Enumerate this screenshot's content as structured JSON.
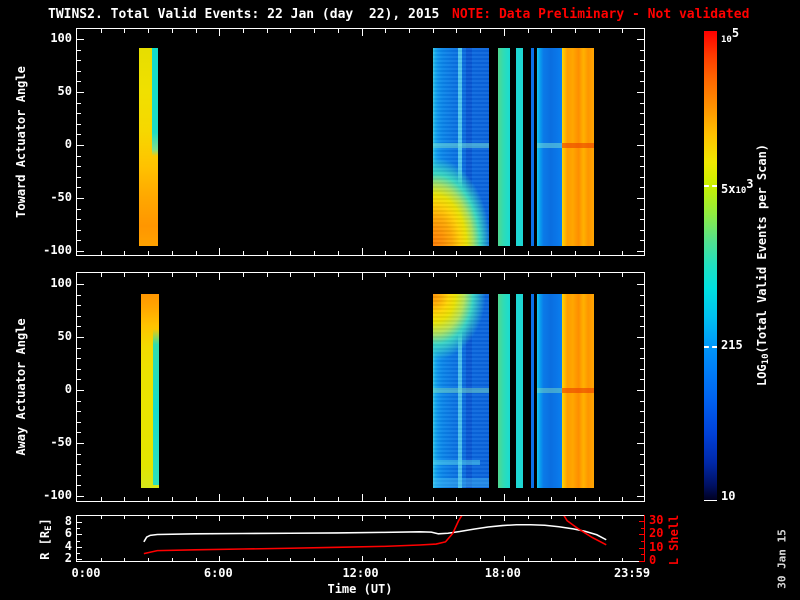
{
  "header": {
    "title": "TWINS2. Total Valid Events: 22 Jan (day  22), 2015",
    "title_color": "#ffffff",
    "note": "NOTE: Data Preliminary - Not validated",
    "note_color": "#ff0000"
  },
  "footer": {
    "date_stamp": "30 Jan 15"
  },
  "time_axis": {
    "label": "Time (UT)",
    "range_hours": [
      0,
      24
    ],
    "ticks": [
      {
        "hour": 0,
        "label": "0:00"
      },
      {
        "hour": 6,
        "label": "6:00"
      },
      {
        "hour": 12,
        "label": "12:00"
      },
      {
        "hour": 18,
        "label": "18:00"
      },
      {
        "hour": 23.983,
        "label": "23:59"
      }
    ]
  },
  "colorbar": {
    "label_pre": "LOG",
    "label_sub": "10",
    "label_suf": "(Total Valid Events per Scan)",
    "gradient": "linear-gradient(180deg,#ff0000 0%,#ff3800 5%,#ff6400 10%,#ff9000 16%,#ffc000 22%,#f0e800 28%,#c8f000 33%,#90ec40 39%,#50e090 45%,#20e0c0 50%,#00e0e0 55%,#00c0f0 61%,#0098f8 67%,#0080f8 72%,#0060f0 79%,#0040d8 86%,#0028a8 92%,#001060 97%,#000020 100%)",
    "scale": "log",
    "range": [
      10,
      100000
    ],
    "ticks": [
      {
        "pre": "",
        "small": "10",
        "sup": "5",
        "value": 100000,
        "frac": 0.0,
        "dashed": false
      },
      {
        "pre": "5x",
        "small": "10",
        "sup": "3",
        "value": 5000,
        "frac": 0.328,
        "dashed": true
      },
      {
        "pre": "215",
        "small": "",
        "sup": "",
        "value": 215,
        "frac": 0.672,
        "dashed": true
      },
      {
        "pre": "10",
        "small": "",
        "sup": "",
        "value": 10,
        "frac": 1.0,
        "dashed": false
      }
    ]
  },
  "chart_data": [
    {
      "id": "toward",
      "type": "heatmap",
      "ylabel": "Toward Actuator Angle",
      "ylim": [
        -100,
        100
      ],
      "yticks": [
        100,
        50,
        0,
        -50,
        -100
      ],
      "bands": [
        {
          "t0": 2.62,
          "t1": 3.43,
          "a0": 92,
          "a1": -95,
          "bg": "linear-gradient(180deg,#e6de00 0%,#f0e000 22%,#f6d800 42%,#ffc200 60%,#ffa800 75%,#ff9600 90%,#ffa200 100%)"
        },
        {
          "t0": 3.16,
          "t1": 3.43,
          "a0": 92,
          "a1": -10,
          "bg": "linear-gradient(180deg,#12dcc8 0%,#1edcc4 78%,#7ee08c 94%,rgba(126,224,140,0) 100%)"
        },
        {
          "t0": 15.02,
          "t1": 17.38,
          "a0": 92,
          "a1": -95,
          "bg": "linear-gradient(90deg,#36c8e2 0%,#14aaee 4%,#0e96ee 9%,#0a88ea 16%,#0a80e8 24%,#0a76e4 36%,#0a6ee0 52%,#0a68de 72%,#0a64dc 100%)"
        },
        {
          "t0": 16.07,
          "t1": 16.24,
          "a0": 92,
          "a1": -95,
          "bg": "rgba(100,226,242,0.75)"
        },
        {
          "t0": 16.41,
          "t1": 16.66,
          "a0": 92,
          "a1": -95,
          "bg": "rgba(6,70,200,0.5)"
        },
        {
          "t0": 15.02,
          "t1": 17.38,
          "a0": 0,
          "a1": -95,
          "bg": "radial-gradient(ellipse 120% 102% at 0% 100%,#ff7c00 0%,#ff8e00 15%,#ffaa00 29%,#ffd200 41%,#eae400 50%,#a6e060 60%,#38d8c0 70%,rgba(10,104,224,0) 86%)"
        },
        {
          "t0": 15.02,
          "t1": 17.38,
          "a0": 92,
          "a1": -95,
          "bg": "repeating-linear-gradient(180deg,rgba(255,255,255,0.05) 0px,rgba(255,255,255,0.05) 2px,rgba(0,0,90,0.06) 2px,rgba(0,0,90,0.06) 4px)"
        },
        {
          "t0": 17.76,
          "t1": 18.26,
          "a0": 92,
          "a1": -95,
          "bg": "linear-gradient(90deg,#52d88e 0%,#2edcb6 48%,#1adcd2 100%)"
        },
        {
          "t0": 18.52,
          "t1": 18.81,
          "a0": 92,
          "a1": -95,
          "bg": "#1ed8d4"
        },
        {
          "t0": 19.15,
          "t1": 19.28,
          "a0": 92,
          "a1": -95,
          "bg": "#0a70e8"
        },
        {
          "t0": 19.4,
          "t1": 20.46,
          "a0": 92,
          "a1": -95,
          "bg": "linear-gradient(90deg,#16cce6 0%,#08a6f0 9%,#0a7ae8 26%,#0a6ee0 55%,#0a76e8 80%,#0a80ee 100%)"
        },
        {
          "t0": 20.46,
          "t1": 21.81,
          "a0": 92,
          "a1": -95,
          "bg": "linear-gradient(90deg,#ffd600 0%,#ffbe00 7%,#ff9e00 17%,#ffa600 34%,#ff8e00 52%,#ffb200 67%,#ff9600 82%,#ffa600 100%)"
        },
        {
          "t0": 15.02,
          "t1": 17.38,
          "a0": 2,
          "a1": -3,
          "bg": "rgba(120,228,214,0.5)"
        },
        {
          "t0": 19.4,
          "t1": 20.46,
          "a0": 2,
          "a1": -3,
          "bg": "rgba(120,228,214,0.5)"
        },
        {
          "t0": 20.46,
          "t1": 21.81,
          "a0": 2,
          "a1": -3,
          "bg": "rgba(235,70,0,0.65)"
        }
      ]
    },
    {
      "id": "away",
      "type": "heatmap",
      "ylabel": "Away Actuator Angle",
      "ylim": [
        -100,
        100
      ],
      "yticks": [
        100,
        50,
        0,
        -50,
        -100
      ],
      "bands": [
        {
          "t0": 2.7,
          "t1": 3.46,
          "a0": 91,
          "a1": -92,
          "bg": "linear-gradient(180deg,#ff9600 0%,#ffa600 7%,#ffc200 16%,#f2da00 27%,#ebe300 42%,#e8e400 68%,#e2e600 88%,#d6e81a 100%)"
        },
        {
          "t0": 3.19,
          "t1": 3.46,
          "a0": 58,
          "a1": -90,
          "bg": "linear-gradient(180deg,rgba(18,220,200,0) 0%,rgba(18,220,200,0.85) 10%,#16dcca 52%,#2ee0ba 100%)"
        },
        {
          "t0": 15.02,
          "t1": 17.38,
          "a0": 91,
          "a1": -92,
          "bg": "linear-gradient(90deg,#36c8e2 0%,#14aaee 4%,#0e96ee 9%,#0a88ea 16%,#0a80e8 24%,#0a76e4 36%,#0a6ee0 52%,#0a68de 72%,#0a64dc 100%)"
        },
        {
          "t0": 16.07,
          "t1": 16.24,
          "a0": 91,
          "a1": -92,
          "bg": "rgba(100,226,242,0.7)"
        },
        {
          "t0": 16.41,
          "t1": 16.66,
          "a0": 91,
          "a1": -92,
          "bg": "rgba(6,70,200,0.5)"
        },
        {
          "t0": 15.02,
          "t1": 17.38,
          "a0": 91,
          "a1": 16,
          "bg": "radial-gradient(ellipse 112% 100% at 0% 0%,#ff9200 0%,#ffae00 13%,#ffd600 25%,#eae400 36%,#b2e45a 50%,#38d4c4 64%,rgba(10,104,224,0) 84%)"
        },
        {
          "t0": 15.02,
          "t1": 17.38,
          "a0": 91,
          "a1": -92,
          "bg": "repeating-linear-gradient(180deg,rgba(255,255,255,0.05) 0px,rgba(255,255,255,0.05) 2px,rgba(0,0,90,0.06) 2px,rgba(0,0,90,0.06) 4px)"
        },
        {
          "t0": 17.76,
          "t1": 18.26,
          "a0": 91,
          "a1": -92,
          "bg": "linear-gradient(90deg,#52d88e 0%,#2edcb6 48%,#1adcd2 100%)"
        },
        {
          "t0": 18.52,
          "t1": 18.81,
          "a0": 91,
          "a1": -92,
          "bg": "#1ed8d4"
        },
        {
          "t0": 19.15,
          "t1": 19.28,
          "a0": 91,
          "a1": -92,
          "bg": "#0a70e8"
        },
        {
          "t0": 19.4,
          "t1": 20.46,
          "a0": 91,
          "a1": -92,
          "bg": "linear-gradient(90deg,#16cce6 0%,#08a6f0 9%,#0a7ae8 26%,#0a6ee0 55%,#0a76e8 80%,#0a80ee 100%)"
        },
        {
          "t0": 20.46,
          "t1": 21.81,
          "a0": 91,
          "a1": -92,
          "bg": "linear-gradient(90deg,#ffd600 0%,#ffbe00 7%,#ff9e00 17%,#ffa600 34%,#ff8e00 52%,#ffb200 67%,#ff9600 82%,#ffa600 100%)"
        },
        {
          "t0": 15.02,
          "t1": 17.0,
          "a0": -66,
          "a1": -71,
          "bg": "rgba(96,222,232,0.45)"
        },
        {
          "t0": 15.02,
          "t1": 17.38,
          "a0": -83,
          "a1": -91,
          "bg": "rgba(86,202,244,0.35)"
        },
        {
          "t0": 15.02,
          "t1": 17.38,
          "a0": 2,
          "a1": -3,
          "bg": "rgba(130,228,190,0.45)"
        },
        {
          "t0": 19.4,
          "t1": 20.46,
          "a0": 2,
          "a1": -3,
          "bg": "rgba(130,228,190,0.45)"
        },
        {
          "t0": 20.46,
          "t1": 21.81,
          "a0": 2,
          "a1": -3,
          "bg": "rgba(235,70,0,0.65)"
        }
      ]
    },
    {
      "id": "orbit",
      "type": "line",
      "left_axis": {
        "label_pre": "R [R",
        "label_sub": "E",
        "label_suf": "]",
        "ticks": [
          8,
          6,
          4,
          2
        ],
        "range": [
          2,
          8
        ],
        "color": "#ffffff"
      },
      "right_axis": {
        "label": "L Shell",
        "ticks": [
          30,
          20,
          10,
          0
        ],
        "range": [
          0,
          30
        ],
        "color": "#ff0000"
      },
      "series": [
        {
          "name": "R [RE]",
          "axis": "left",
          "color": "#ffffff",
          "points": [
            [
              2.83,
              4.6
            ],
            [
              2.95,
              5.4
            ],
            [
              3.1,
              5.7
            ],
            [
              3.4,
              5.85
            ],
            [
              5,
              5.95
            ],
            [
              7,
              6.0
            ],
            [
              9,
              6.05
            ],
            [
              11,
              6.1
            ],
            [
              13,
              6.2
            ],
            [
              14.5,
              6.3
            ],
            [
              15.0,
              6.25
            ],
            [
              15.3,
              5.95
            ],
            [
              15.7,
              6.05
            ],
            [
              16.2,
              6.35
            ],
            [
              16.8,
              6.75
            ],
            [
              17.4,
              7.1
            ],
            [
              18.0,
              7.35
            ],
            [
              18.6,
              7.5
            ],
            [
              19.2,
              7.5
            ],
            [
              19.8,
              7.4
            ],
            [
              20.4,
              7.15
            ],
            [
              21.0,
              6.8
            ],
            [
              21.5,
              6.4
            ],
            [
              22.0,
              5.8
            ],
            [
              22.4,
              4.95
            ]
          ]
        },
        {
          "name": "L Shell",
          "axis": "right",
          "color": "#ff0000",
          "points": [
            [
              2.83,
              4.3
            ],
            [
              3.4,
              6.6
            ],
            [
              5,
              7.3
            ],
            [
              7,
              7.9
            ],
            [
              9,
              8.5
            ],
            [
              11,
              9.2
            ],
            [
              13,
              10.0
            ],
            [
              14.5,
              11.0
            ],
            [
              15.2,
              11.8
            ],
            [
              15.6,
              13.5
            ],
            [
              15.9,
              20.0
            ],
            [
              16.15,
              30.0
            ],
            [
              16.35,
              36.0
            ],
            [
              20.55,
              36.0
            ],
            [
              20.75,
              30.0
            ],
            [
              21.2,
              24.0
            ],
            [
              21.8,
              17.0
            ],
            [
              22.4,
              11.2
            ]
          ]
        }
      ]
    }
  ]
}
